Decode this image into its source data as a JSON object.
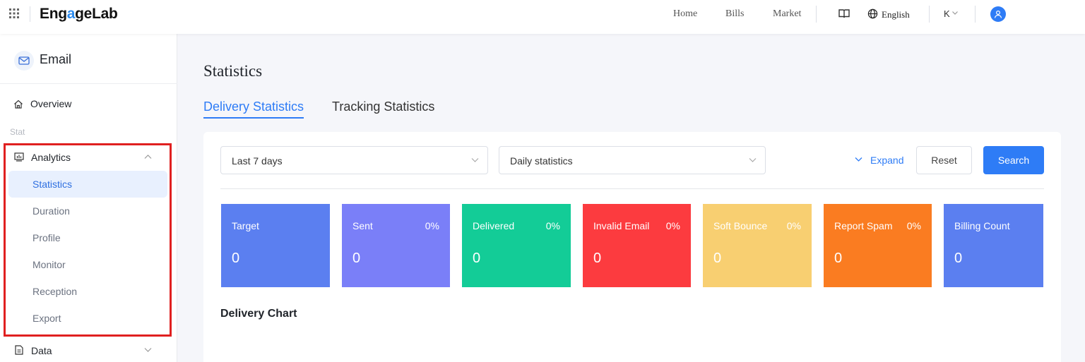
{
  "header": {
    "logo": {
      "pre": "Eng",
      "accent": "a",
      "post": "geLab"
    },
    "links": [
      "Home",
      "Bills",
      "Market"
    ],
    "language": "English",
    "user_initial": "K"
  },
  "sidebar": {
    "product": "Email",
    "overview": "Overview",
    "section": "Stat",
    "analytics": "Analytics",
    "sub_items": [
      "Statistics",
      "Duration",
      "Profile",
      "Monitor",
      "Reception",
      "Export"
    ],
    "active_sub": "Statistics",
    "data": "Data"
  },
  "main": {
    "title": "Statistics",
    "tabs": [
      "Delivery Statistics",
      "Tracking Statistics"
    ],
    "active_tab": "Delivery Statistics",
    "filters": {
      "range": "Last 7 days",
      "granularity": "Daily statistics",
      "expand": "Expand",
      "reset": "Reset",
      "search": "Search"
    },
    "stats": [
      {
        "label": "Target",
        "percent": "",
        "value": "0",
        "color": "#5b7ff0"
      },
      {
        "label": "Sent",
        "percent": "0%",
        "value": "0",
        "color": "#7a7ff8"
      },
      {
        "label": "Delivered",
        "percent": "0%",
        "value": "0",
        "color": "#13cc97"
      },
      {
        "label": "Invalid Email",
        "percent": "0%",
        "value": "0",
        "color": "#fc3b3f"
      },
      {
        "label": "Soft Bounce",
        "percent": "0%",
        "value": "0",
        "color": "#f8cf71"
      },
      {
        "label": "Report Spam",
        "percent": "0%",
        "value": "0",
        "color": "#fa7c21"
      },
      {
        "label": "Billing Count",
        "percent": "",
        "value": "0",
        "color": "#5b7ff0"
      }
    ],
    "chart_title": "Delivery Chart"
  },
  "colors": {
    "accent": "#2e7cf6",
    "highlight": "#e02020"
  }
}
